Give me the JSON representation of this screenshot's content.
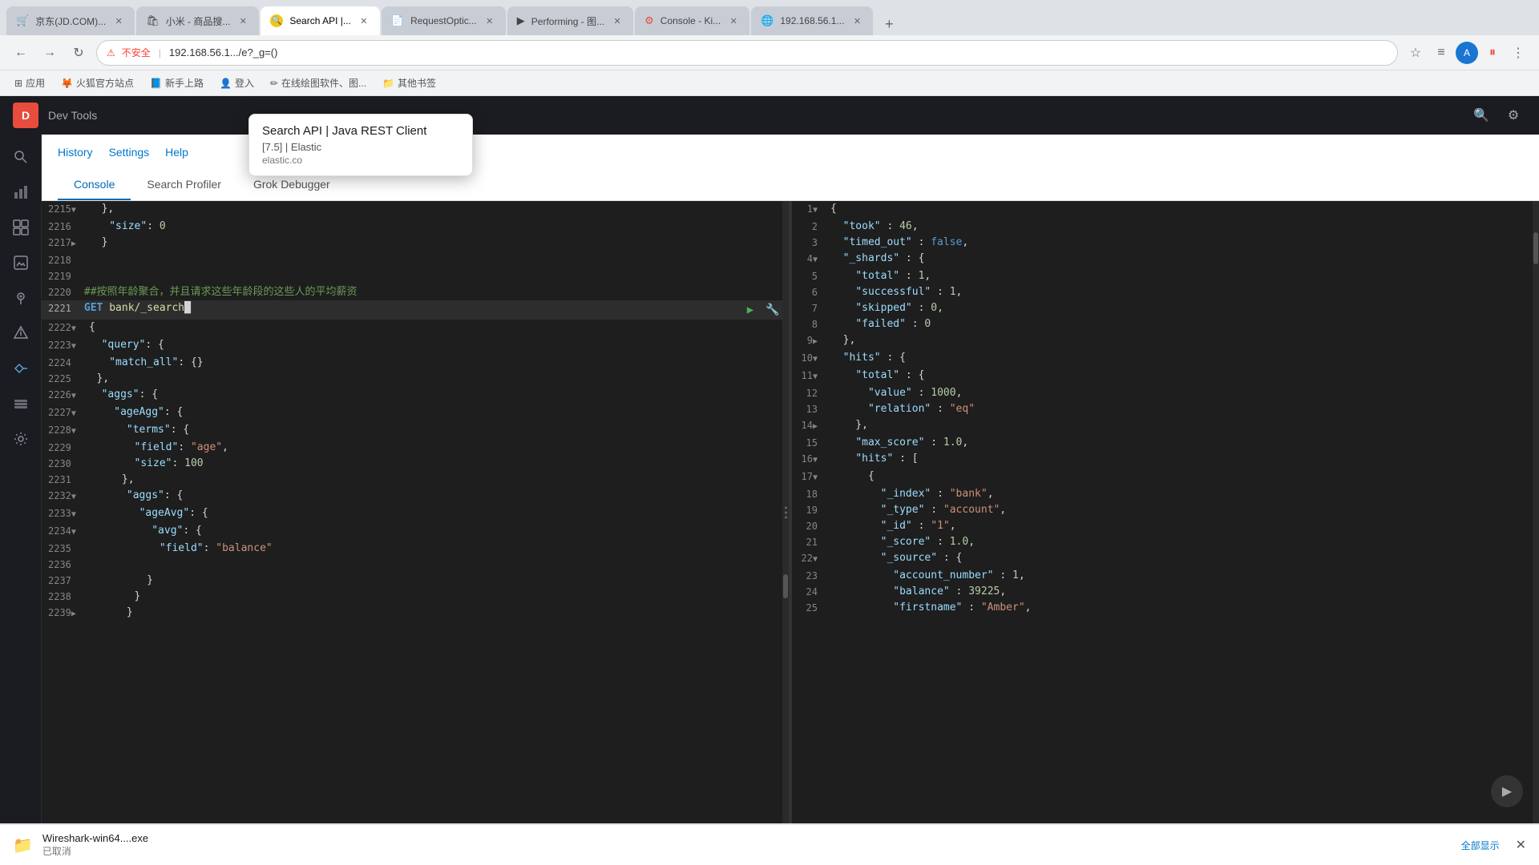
{
  "browser": {
    "tabs": [
      {
        "id": "jd1",
        "favicon": "🛒",
        "title": "京东(JD.COM)...",
        "active": false,
        "closeable": true
      },
      {
        "id": "jd2",
        "favicon": "🛍",
        "title": "小米 - 商品搜...",
        "active": false,
        "closeable": true
      },
      {
        "id": "search-api",
        "favicon": "🔍",
        "title": "Search API |...",
        "active": true,
        "closeable": true
      },
      {
        "id": "request",
        "favicon": "📄",
        "title": "RequestOptic...",
        "active": false,
        "closeable": true
      },
      {
        "id": "performing",
        "favicon": "▶",
        "title": "Performing - 图...",
        "active": false,
        "closeable": true
      },
      {
        "id": "console-ki",
        "favicon": "⚙",
        "title": "Console - Ki...",
        "active": false,
        "closeable": true
      },
      {
        "id": "ip",
        "favicon": "🌐",
        "title": "192.168.56.1...",
        "active": false,
        "closeable": true
      }
    ],
    "new_tab_label": "+",
    "address": "192.168.56.1...",
    "address_warning": "不安全",
    "address_full": "192.168.56.1.../e?_g=()"
  },
  "tooltip": {
    "title": "Search API | Java REST Client",
    "subtitle": "[7.5] | Elastic",
    "url": "elastic.co"
  },
  "bookmarks": [
    {
      "label": "应用"
    },
    {
      "label": "火狐官方站点"
    },
    {
      "label": "新手上路"
    },
    {
      "label": "登入"
    },
    {
      "label": "在线绘图软件、图..."
    },
    {
      "label": "其他书签"
    }
  ],
  "kibana": {
    "logo_letter": "D",
    "breadcrumb": "Dev Tools"
  },
  "devtools": {
    "actions": [
      "History",
      "Settings",
      "Help"
    ],
    "tabs": [
      "Console",
      "Search Profiler",
      "Grok Debugger"
    ],
    "active_tab": "Console"
  },
  "left_code": {
    "lines": [
      {
        "num": "2215",
        "arrow": "▼",
        "content": "  },"
      },
      {
        "num": "2216",
        "content": "    \"size\": 0"
      },
      {
        "num": "2217",
        "arrow": "▶",
        "content": "  }"
      },
      {
        "num": "2218",
        "content": ""
      },
      {
        "num": "2219",
        "content": ""
      },
      {
        "num": "2220",
        "content": "##按照年龄聚合，并且请求这些年龄段的这些人的平均薪资",
        "type": "comment"
      },
      {
        "num": "2221",
        "content": "GET bank/_search",
        "type": "method",
        "active": true
      },
      {
        "num": "2222",
        "arrow": "▼",
        "content": "{"
      },
      {
        "num": "2223",
        "arrow": "▼",
        "content": "  \"query\": {"
      },
      {
        "num": "2224",
        "content": "    \"match_all\": {}"
      },
      {
        "num": "2225",
        "content": "  },"
      },
      {
        "num": "2226",
        "arrow": "▼",
        "content": "  \"aggs\": {"
      },
      {
        "num": "2227",
        "arrow": "▼",
        "content": "    \"ageAgg\": {"
      },
      {
        "num": "2228",
        "arrow": "▼",
        "content": "      \"terms\": {"
      },
      {
        "num": "2229",
        "content": "        \"field\": \"age\","
      },
      {
        "num": "2230",
        "content": "        \"size\": 100"
      },
      {
        "num": "2231",
        "content": "      },"
      },
      {
        "num": "2232",
        "arrow": "▼",
        "content": "      \"aggs\": {"
      },
      {
        "num": "2233",
        "arrow": "▼",
        "content": "        \"ageAvg\": {"
      },
      {
        "num": "2234",
        "arrow": "▼",
        "content": "          \"avg\": {"
      },
      {
        "num": "2235",
        "content": "            \"field\": \"balance\""
      },
      {
        "num": "2236",
        "content": ""
      },
      {
        "num": "2237",
        "content": "          }"
      },
      {
        "num": "2238",
        "content": "        }"
      },
      {
        "num": "2239",
        "arrow": "▶",
        "content": "      }"
      }
    ]
  },
  "right_code": {
    "lines": [
      {
        "num": "1",
        "arrow": "▼",
        "content": "{"
      },
      {
        "num": "2",
        "content": "  \"took\" : 46,"
      },
      {
        "num": "3",
        "content": "  \"timed_out\" : false,"
      },
      {
        "num": "4",
        "arrow": "▼",
        "content": "  \"_shards\" : {"
      },
      {
        "num": "5",
        "content": "    \"total\" : 1,"
      },
      {
        "num": "6",
        "content": "    \"successful\" : 1,"
      },
      {
        "num": "7",
        "content": "    \"skipped\" : 0,"
      },
      {
        "num": "8",
        "content": "    \"failed\" : 0"
      },
      {
        "num": "9",
        "arrow": "▶",
        "content": "  },"
      },
      {
        "num": "10",
        "arrow": "▼",
        "content": "  \"hits\" : {"
      },
      {
        "num": "11",
        "arrow": "▼",
        "content": "    \"total\" : {"
      },
      {
        "num": "12",
        "content": "      \"value\" : 1000,"
      },
      {
        "num": "13",
        "content": "      \"relation\" : \"eq\""
      },
      {
        "num": "14",
        "arrow": "▶",
        "content": "    },"
      },
      {
        "num": "15",
        "content": "    \"max_score\" : 1.0,"
      },
      {
        "num": "16",
        "arrow": "▼",
        "content": "    \"hits\" : ["
      },
      {
        "num": "17",
        "arrow": "▼",
        "content": "      {"
      },
      {
        "num": "18",
        "content": "        \"_index\" : \"bank\","
      },
      {
        "num": "19",
        "content": "        \"_type\" : \"account\","
      },
      {
        "num": "20",
        "content": "        \"_id\" : \"1\","
      },
      {
        "num": "21",
        "content": "        \"_score\" : 1.0,"
      },
      {
        "num": "22",
        "arrow": "▼",
        "content": "        \"_source\" : {"
      },
      {
        "num": "23",
        "content": "          \"account_number\" : 1,"
      },
      {
        "num": "24",
        "content": "          \"balance\" : 39225,"
      },
      {
        "num": "25",
        "content": "          \"firstname\" : \"Amber\","
      }
    ]
  },
  "sidebar_icons": [
    {
      "name": "discover-icon",
      "symbol": "🔍"
    },
    {
      "name": "visualize-icon",
      "symbol": "📊"
    },
    {
      "name": "dashboard-icon",
      "symbol": "▦"
    },
    {
      "name": "canvas-icon",
      "symbol": "🖼"
    },
    {
      "name": "maps-icon",
      "symbol": "🗺"
    },
    {
      "name": "ml-icon",
      "symbol": "⚡"
    },
    {
      "name": "devtools-icon",
      "symbol": "⚙",
      "active": true
    },
    {
      "name": "stack-icon",
      "symbol": "📦"
    },
    {
      "name": "management-icon",
      "symbol": "🔧"
    }
  ],
  "download": {
    "name": "Wireshark-win64....exe",
    "status": "已取消",
    "action_label": "全部显示"
  }
}
